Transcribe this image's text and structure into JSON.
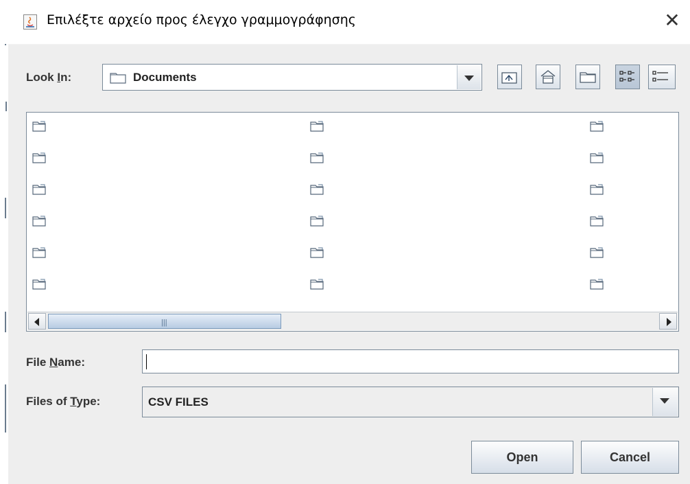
{
  "dialog": {
    "title": "Επιλέξτε αρχείο προς έλεγχο γραμμογράφησης",
    "close_glyph": "✕"
  },
  "look_in": {
    "label_pre": "Look ",
    "label_mnemonic": "I",
    "label_post": "n:",
    "value": "Documents"
  },
  "toolbar": {
    "buttons": [
      "up-one-level",
      "home",
      "create-new-folder",
      "list-view",
      "details-view"
    ],
    "pressed": "list-view"
  },
  "file_list": {
    "columns": 3,
    "rows": 6,
    "item_icon": "folder-icon",
    "item_names": []
  },
  "file_name": {
    "label_pre": "File ",
    "label_mnemonic": "N",
    "label_post": "ame:",
    "value": ""
  },
  "files_of_type": {
    "label_pre": "Files of ",
    "label_mnemonic": "T",
    "label_post": "ype:",
    "value": "CSV FILES"
  },
  "actions": {
    "open_label": "Open",
    "cancel_label": "Cancel"
  },
  "colors": {
    "background": "#eeeeee",
    "border": "#7a8a99",
    "button_gradient_bottom": "#d6dee8"
  }
}
